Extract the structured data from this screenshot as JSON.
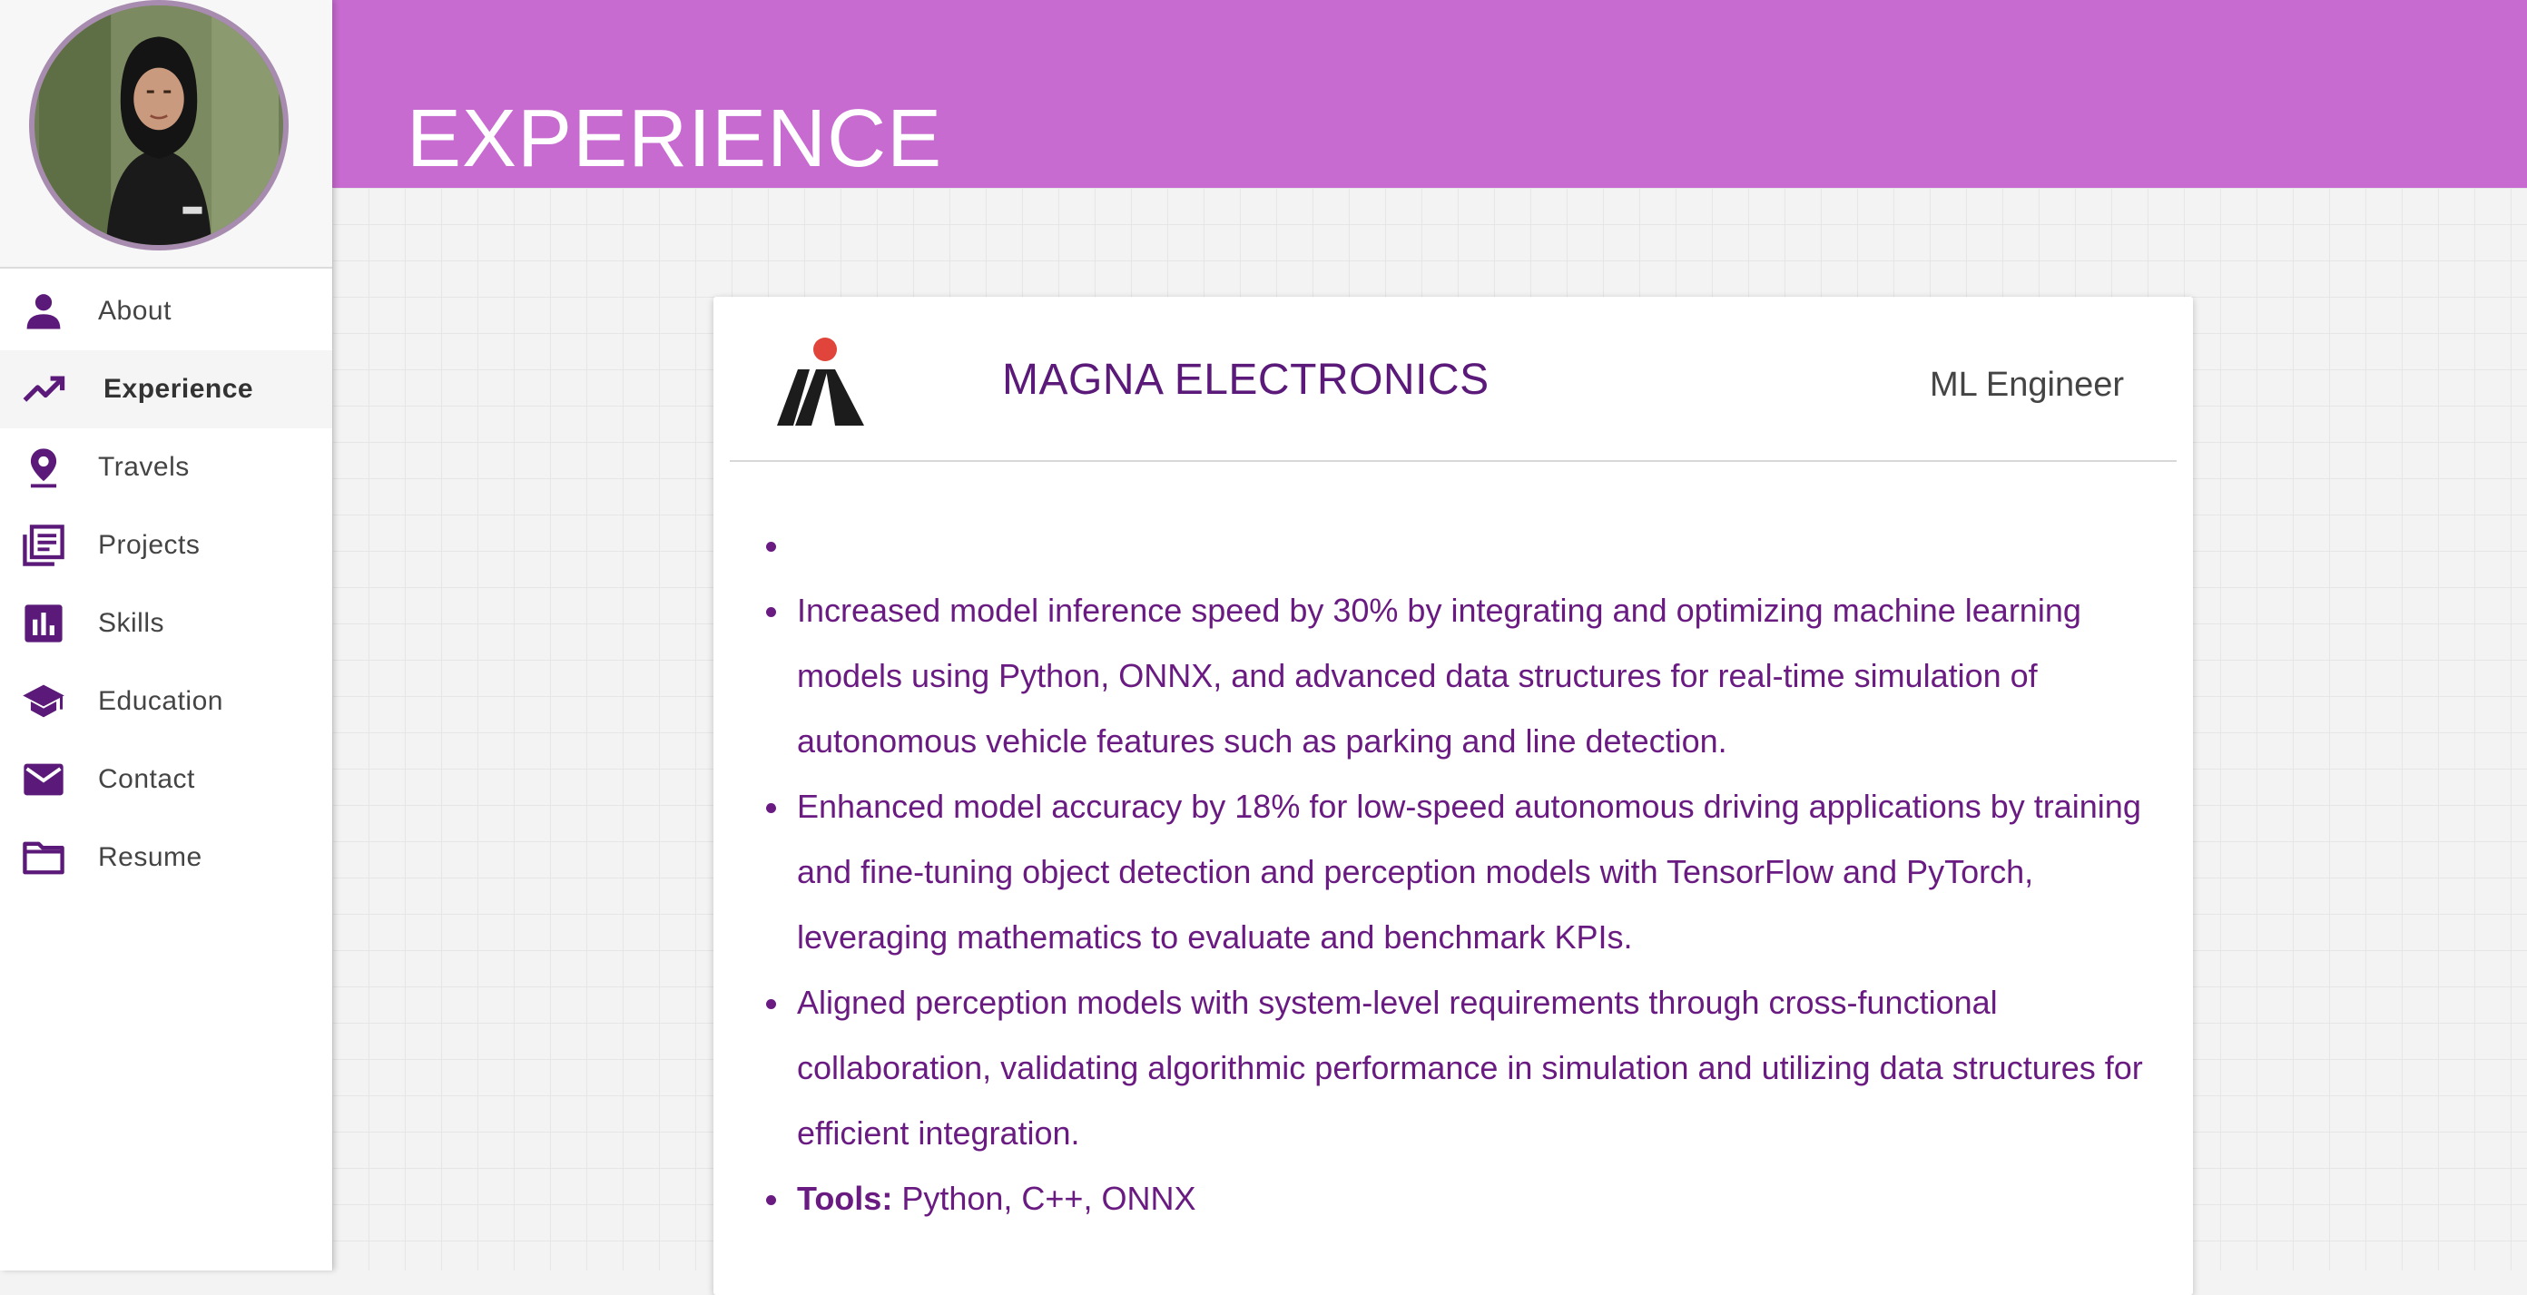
{
  "colors": {
    "header_bg": "#c86bd0",
    "accent_purple": "#5b1a7a",
    "bullet_text": "#6a1b82",
    "logo_dot": "#e0443a"
  },
  "sidebar": {
    "avatar_alt": "profile photo",
    "items": [
      {
        "label": "About",
        "icon": "person-icon"
      },
      {
        "label": "Experience",
        "icon": "trending-up-icon",
        "active": true
      },
      {
        "label": "Travels",
        "icon": "map-pin-icon"
      },
      {
        "label": "Projects",
        "icon": "library-books-icon"
      },
      {
        "label": "Skills",
        "icon": "bar-chart-icon"
      },
      {
        "label": "Education",
        "icon": "graduation-cap-icon"
      },
      {
        "label": "Contact",
        "icon": "mail-icon"
      },
      {
        "label": "Resume",
        "icon": "folder-icon"
      }
    ]
  },
  "header": {
    "title": "EXPERIENCE"
  },
  "experience": {
    "company": "MAGNA ELECTRONICS",
    "role": "ML Engineer",
    "logo_icon": "magna-logo-icon",
    "bullets": [
      "",
      "Increased model inference speed by 30% by integrating and optimizing machine learning models using Python, ONNX, and advanced data structures for real-time simulation of autonomous vehicle features such as parking and line detection.",
      "Enhanced model accuracy by 18% for low-speed autonomous driving applications by training and fine-tuning object detection and perception models with TensorFlow and PyTorch, leveraging mathematics to evaluate and benchmark KPIs.",
      "Aligned perception models with system-level requirements through cross-functional collaboration, validating algorithmic performance in simulation and utilizing data structures for efficient integration."
    ],
    "tools_label": "Tools:",
    "tools_value": " Python, C++, ONNX"
  }
}
